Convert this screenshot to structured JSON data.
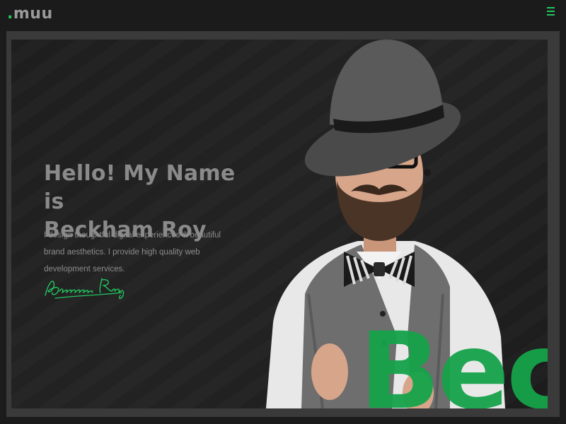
{
  "header": {
    "logo_dot": ".",
    "logo_text": "muu",
    "menu_icon": "hamburger-menu-icon"
  },
  "hero": {
    "title_line1": "Hello! My Name is",
    "title_line2": "Beckham Roy",
    "description": "I design thoughtful digital experiences & beautiful brand aesthetics. I provide high quality web development services.",
    "signature_text": "Beckham Roy",
    "watermark": "Beck"
  },
  "colors": {
    "accent": "#22c55e",
    "background": "#1b1b1b",
    "frame": "#3a3a3a"
  }
}
